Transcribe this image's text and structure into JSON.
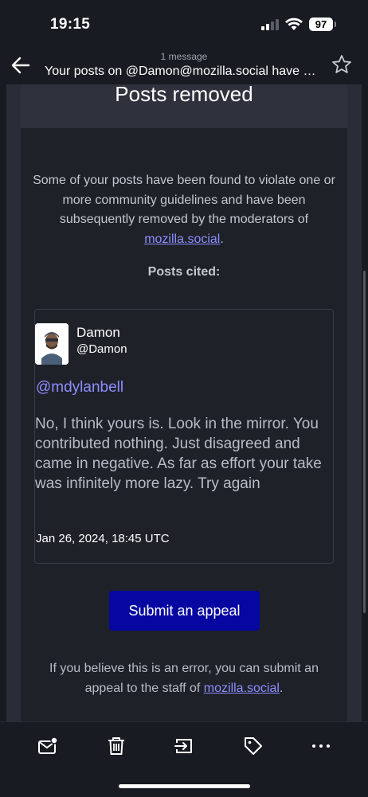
{
  "status_bar": {
    "time": "19:15",
    "battery": "97"
  },
  "header": {
    "message_count": "1 message",
    "subject": "Your posts on @Damon@mozilla.social have been removed",
    "back_icon": "back-arrow-icon",
    "star_icon": "star-icon"
  },
  "email": {
    "title": "Posts removed",
    "intro_text": "Some of your posts have been found to violate one or more community guidelines and have been subsequently removed by the moderators of ",
    "intro_link": "mozilla.social",
    "intro_end": ".",
    "posts_cited_label": "Posts cited:",
    "post": {
      "author_name": "Damon",
      "author_handle": "@Damon",
      "mention": "@mdylanbell",
      "text": "No, I think yours is. Look in the mirror. You contributed nothing. Just disagreed and came in negative. As far as effort your take was infinitely more lazy. Try again",
      "date": "Jan 26, 2024, 18:45 UTC"
    },
    "appeal_button": "Submit an appeal",
    "footer_text": "If you believe this is an error, you can submit an appeal to the staff of ",
    "footer_link": "mozilla.social",
    "footer_end": "."
  },
  "toolbar": {
    "items": [
      {
        "icon": "mark-unread-icon"
      },
      {
        "icon": "trash-icon"
      },
      {
        "icon": "move-to-folder-icon"
      },
      {
        "icon": "tag-icon"
      },
      {
        "icon": "more-icon"
      }
    ]
  },
  "colors": {
    "background": "#191b22",
    "card": "#1f2129",
    "accent_link": "#8c8dff",
    "button": "#0607a1"
  }
}
